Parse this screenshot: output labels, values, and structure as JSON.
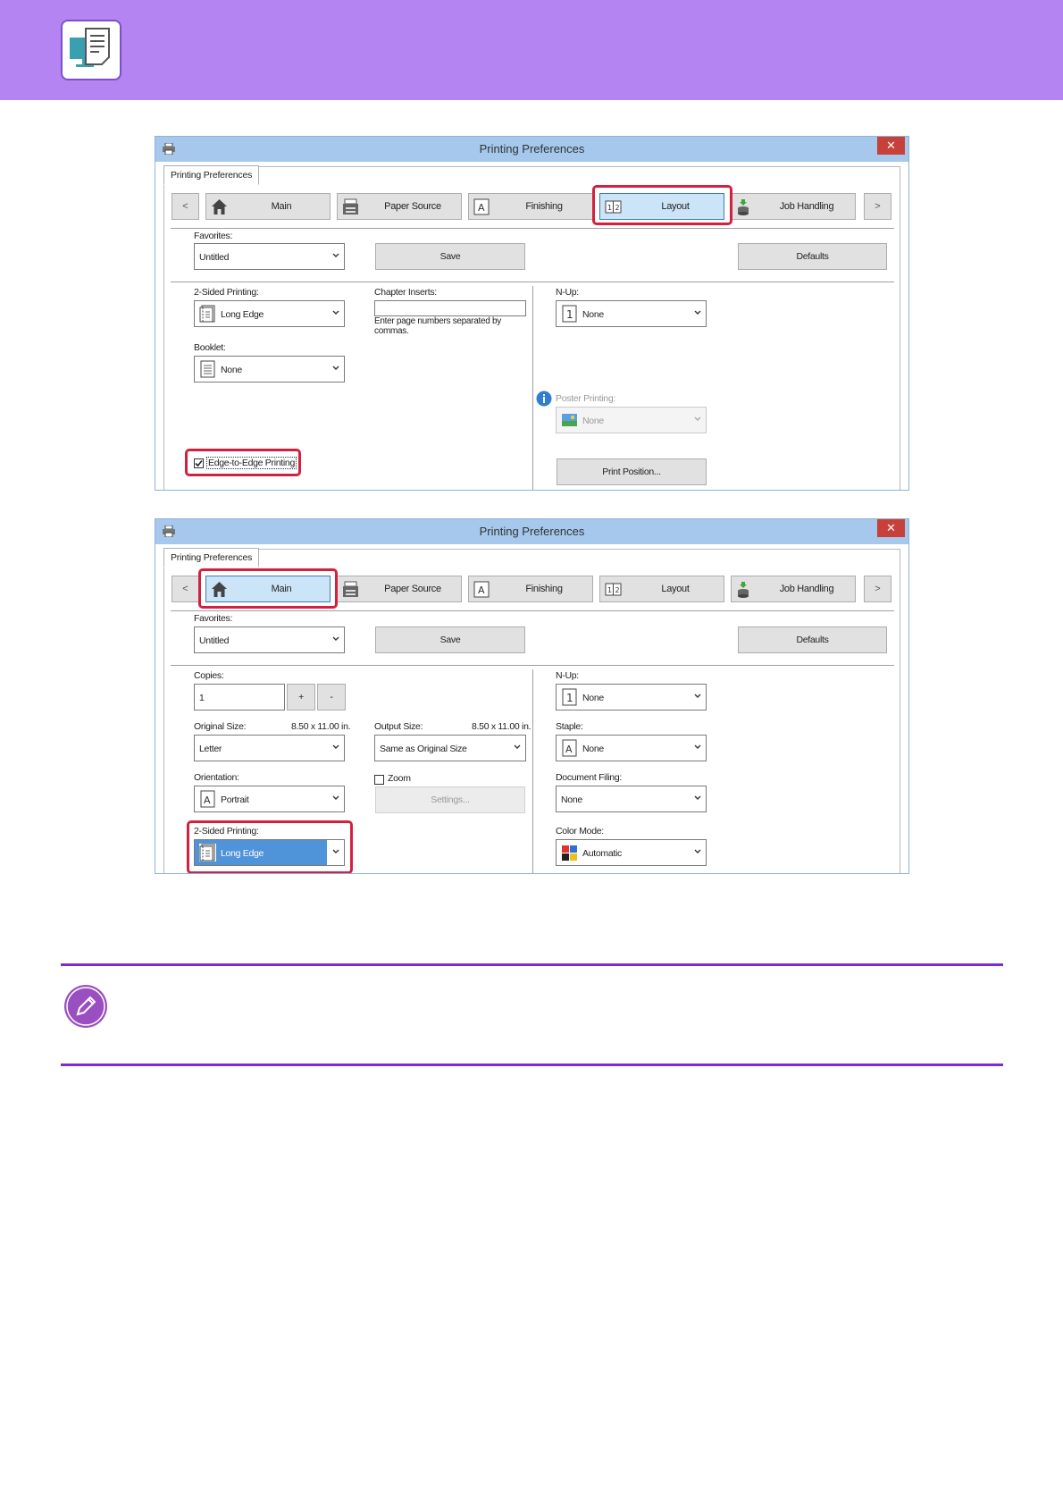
{
  "header": {
    "icon": "print-monitor-icon",
    "color": "#b384f2"
  },
  "window1": {
    "title": "Printing Preferences",
    "close": "✕",
    "tab": "Printing Preferences",
    "nav": {
      "prev": "<",
      "next": ">",
      "main": "Main",
      "paper": "Paper Source",
      "finishing": "Finishing",
      "layout": "Layout",
      "job": "Job Handling"
    },
    "favorites_label": "Favorites:",
    "favorites_value": "Untitled",
    "save": "Save",
    "defaults": "Defaults",
    "two_sided_label": "2-Sided Printing:",
    "two_sided_value": "Long Edge",
    "chapter_label": "Chapter Inserts:",
    "chapter_hint": "Enter page numbers separated by commas.",
    "nup_label": "N-Up:",
    "nup_value": "None",
    "booklet_label": "Booklet:",
    "booklet_value": "None",
    "poster_label": "Poster Printing:",
    "poster_value": "None",
    "edge_label": "Edge-to-Edge Printing",
    "print_position": "Print Position..."
  },
  "window2": {
    "title": "Printing Preferences",
    "close": "✕",
    "tab": "Printing Preferences",
    "nav": {
      "prev": "<",
      "next": ">",
      "main": "Main",
      "paper": "Paper Source",
      "finishing": "Finishing",
      "layout": "Layout",
      "job": "Job Handling"
    },
    "favorites_label": "Favorites:",
    "favorites_value": "Untitled",
    "save": "Save",
    "defaults": "Defaults",
    "copies_label": "Copies:",
    "copies_value": "1",
    "plus": "+",
    "minus": "-",
    "nup_label": "N-Up:",
    "nup_value": "None",
    "original_size_label": "Original Size:",
    "original_size_dims": "8.50 x 11.00 in.",
    "original_size_value": "Letter",
    "output_size_label": "Output Size:",
    "output_size_dims": "8.50 x 11.00 in.",
    "output_size_value": "Same as Original Size",
    "staple_label": "Staple:",
    "staple_value": "None",
    "orientation_label": "Orientation:",
    "orientation_value": "Portrait",
    "zoom_label": "Zoom",
    "settings": "Settings...",
    "filing_label": "Document Filing:",
    "filing_value": "None",
    "two_sided_label": "2-Sided Printing:",
    "two_sided_value": "Long Edge",
    "color_label": "Color Mode:",
    "color_value": "Automatic"
  },
  "colors": {
    "highlight": "#d3203f",
    "rule": "#7a2bd1",
    "accent": "#b384f2"
  }
}
